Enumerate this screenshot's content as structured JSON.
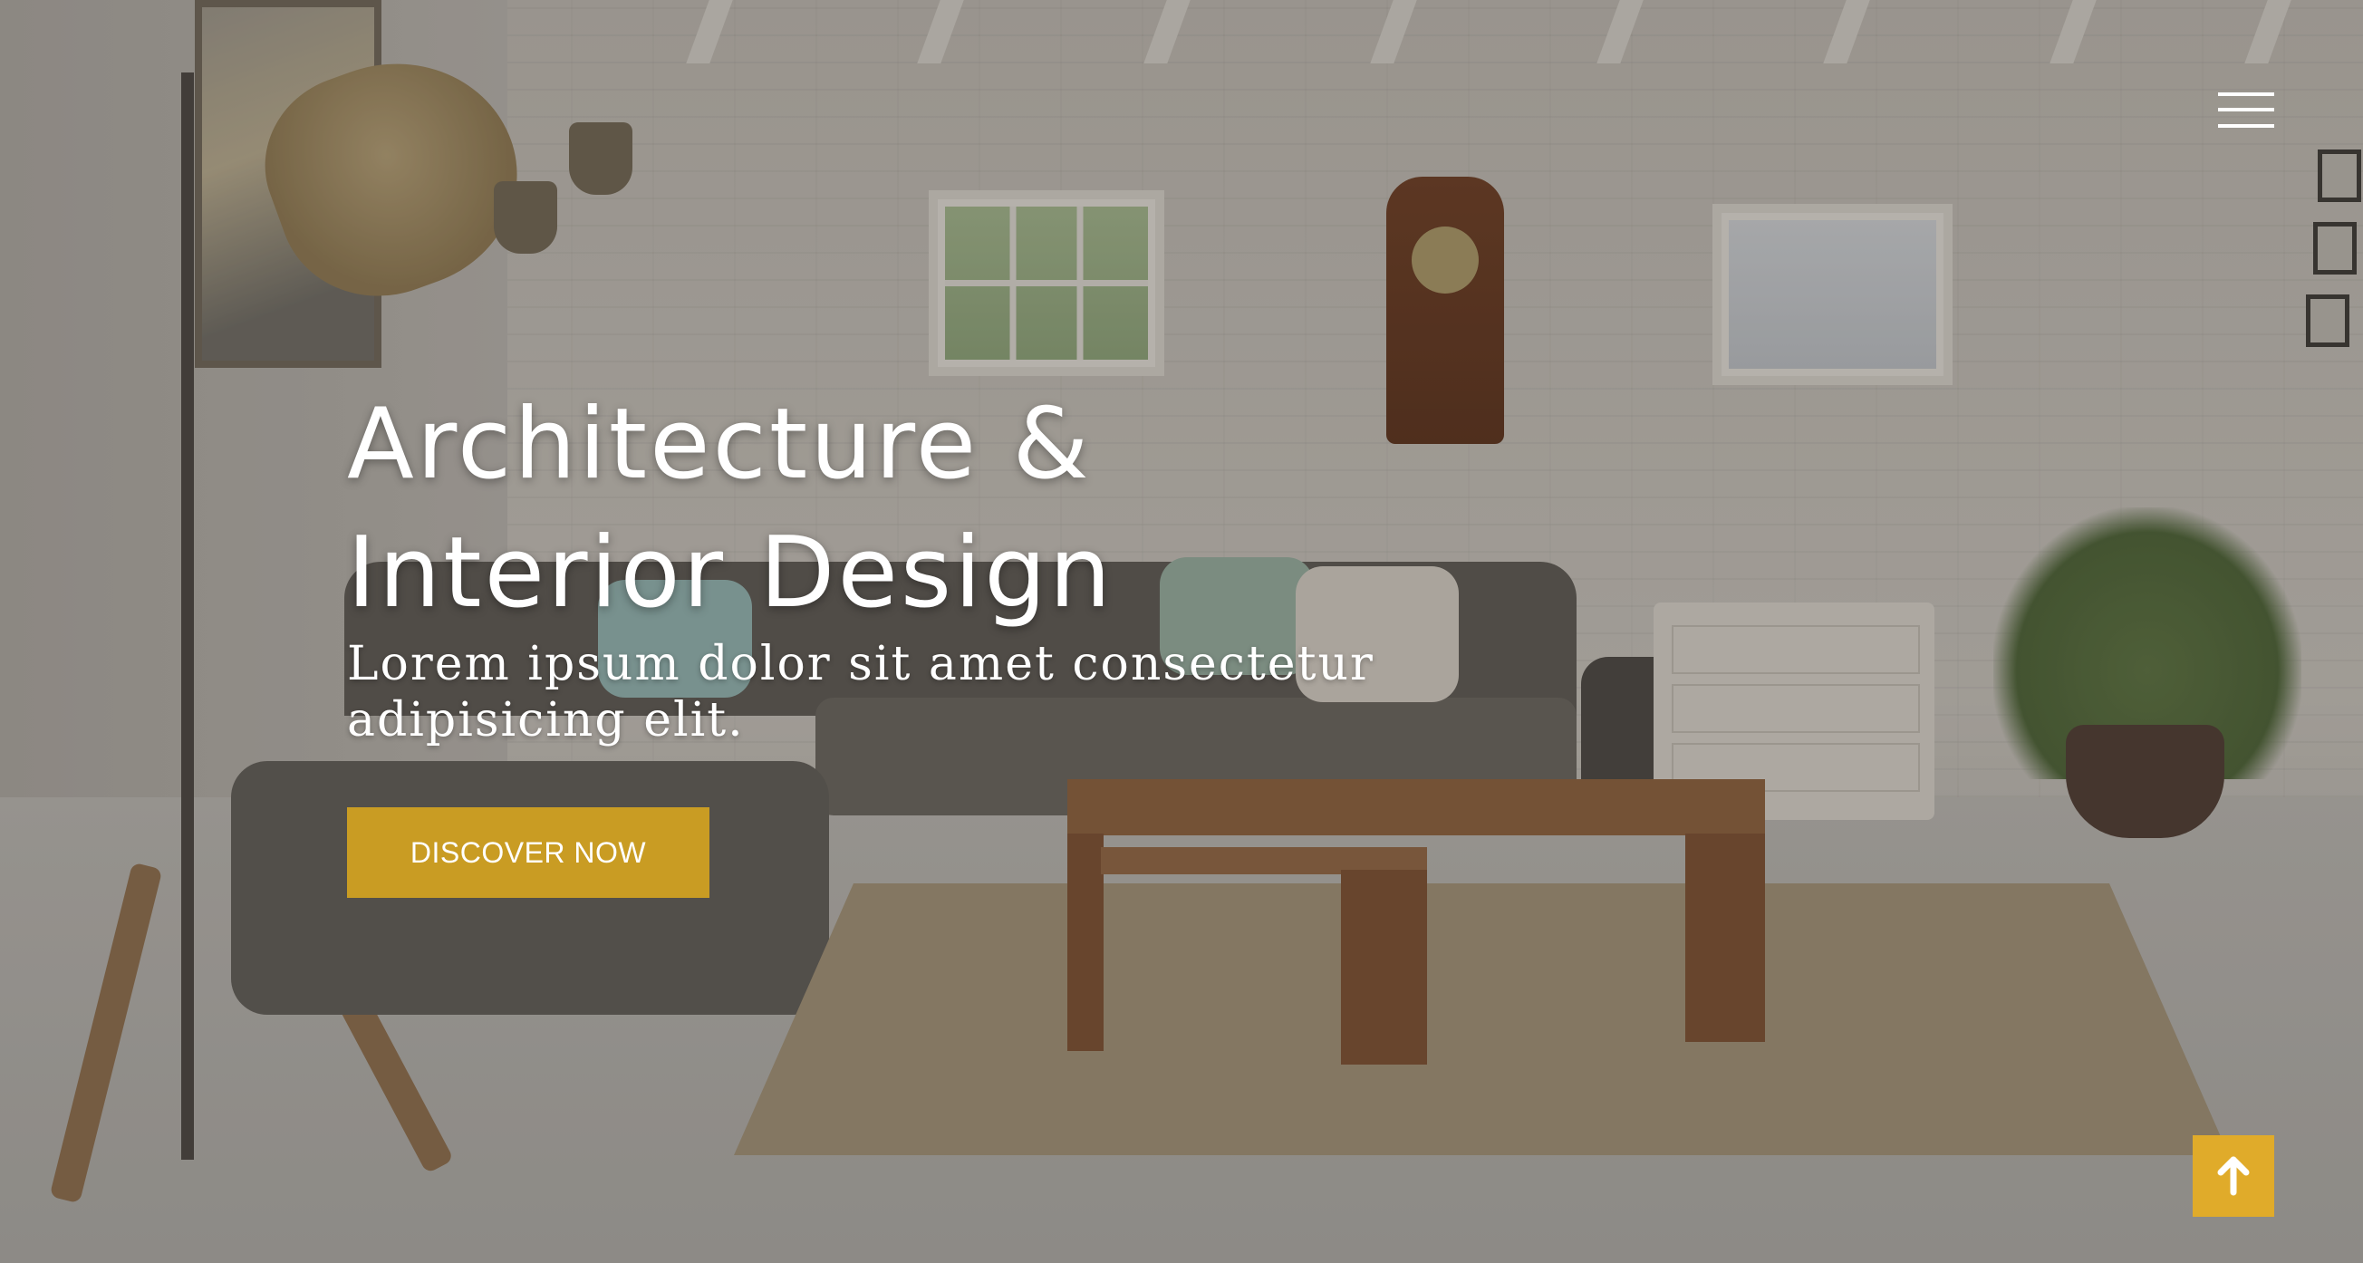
{
  "hero": {
    "title": "Architecture & Interior Design",
    "subtitle": "Lorem ipsum dolor sit amet consectetur adipisicing elit.",
    "cta_label": "DISCOVER NOW",
    "background_image": "living-room-interior-photo"
  },
  "nav": {
    "menu_icon": "hamburger-menu-icon"
  },
  "scroll_top": {
    "icon": "arrow-up-icon"
  },
  "colors": {
    "accent": "#c99c23",
    "scroll_button": "#e0ab2a",
    "text": "#ffffff",
    "overlay": "rgba(40,36,32,0.22)"
  }
}
